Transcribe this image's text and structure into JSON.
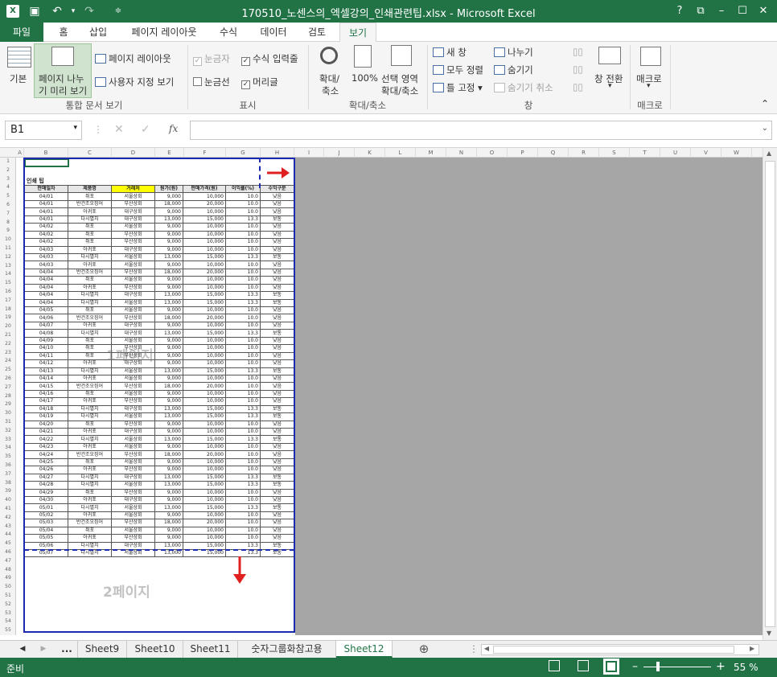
{
  "title": "170510_노센스의_엑셀강의_인쇄관련팁.xlsx - Microsoft Excel",
  "app_logo": "X",
  "window_controls": [
    "?",
    "⧉",
    "–",
    "☐",
    "✕"
  ],
  "tabs": [
    "파일",
    "홈",
    "삽입",
    "페이지 레이아웃",
    "수식",
    "데이터",
    "검토",
    "보기"
  ],
  "ribbon": {
    "normal": "기본",
    "page_break_1": "페이지 나누",
    "page_break_2": "기 미리 보기",
    "page_layout": "페이지 레이아웃",
    "custom_views": "사용자 지정 보기",
    "group_views": "통합 문서 보기",
    "ruler": "눈금자",
    "formula_bar": "수식 입력줄",
    "gridlines": "눈금선",
    "headings": "머리글",
    "group_show": "표시",
    "zoom_1": "확대/",
    "zoom_2": "축소",
    "zoom100": "100%",
    "zoom_sel_1": "선택 영역",
    "zoom_sel_2": "확대/축소",
    "group_zoom": "확대/축소",
    "new_window": "새 창",
    "arrange_all": "모두 정렬",
    "freeze": "틀 고정",
    "split": "나누기",
    "hide": "숨기기",
    "unhide": "숨기기 취소",
    "switch_1": "창 전환",
    "group_window": "창",
    "macro": "매크로",
    "group_macro": "매크로"
  },
  "name_box": "B1",
  "fx": "fx",
  "columns": [
    "A",
    "B",
    "C",
    "D",
    "E",
    "F",
    "G",
    "H",
    "I",
    "J",
    "K",
    "L",
    "M",
    "N",
    "O",
    "P",
    "Q",
    "R",
    "S",
    "T",
    "U",
    "V",
    "W"
  ],
  "sheet_title": "인쇄 팁",
  "headers": [
    "판매일자",
    "제품명",
    "거래처",
    "원가(원)",
    "판매가격(원)",
    "이익률(%)",
    "수익구분"
  ],
  "rows": [
    [
      "04/01",
      "쥐포",
      "서울상회",
      "9,000",
      "10,000",
      "10.0",
      "낮음"
    ],
    [
      "04/01",
      "반건조오징어",
      "부산상회",
      "18,000",
      "20,000",
      "10.0",
      "낮음"
    ],
    [
      "04/01",
      "아귀포",
      "대구상회",
      "9,000",
      "10,000",
      "10.0",
      "낮음"
    ],
    [
      "04/01",
      "다시멸치",
      "대구상회",
      "13,000",
      "15,000",
      "13.3",
      "보통"
    ],
    [
      "04/02",
      "쥐포",
      "서울상회",
      "9,000",
      "10,000",
      "10.0",
      "낮음"
    ],
    [
      "04/02",
      "쥐포",
      "부산상회",
      "9,000",
      "10,000",
      "10.0",
      "낮음"
    ],
    [
      "04/02",
      "쥐포",
      "부산상회",
      "9,000",
      "10,000",
      "10.0",
      "낮음"
    ],
    [
      "04/03",
      "아귀포",
      "대구상회",
      "9,000",
      "10,000",
      "10.0",
      "낮음"
    ],
    [
      "04/03",
      "다시멸치",
      "서울상회",
      "13,000",
      "15,000",
      "13.3",
      "보통"
    ],
    [
      "04/03",
      "아귀포",
      "서울상회",
      "9,000",
      "10,000",
      "10.0",
      "낮음"
    ],
    [
      "04/04",
      "반건조오징어",
      "부산상회",
      "18,000",
      "20,000",
      "10.0",
      "낮음"
    ],
    [
      "04/04",
      "쥐포",
      "서울상회",
      "9,000",
      "10,000",
      "10.0",
      "낮음"
    ],
    [
      "04/04",
      "아귀포",
      "부산상회",
      "9,000",
      "10,000",
      "10.0",
      "낮음"
    ],
    [
      "04/04",
      "다시멸치",
      "대구상회",
      "13,000",
      "15,000",
      "13.3",
      "보통"
    ],
    [
      "04/04",
      "다시멸치",
      "서울상회",
      "13,000",
      "15,000",
      "13.3",
      "보통"
    ],
    [
      "04/05",
      "쥐포",
      "서울상회",
      "9,000",
      "10,000",
      "10.0",
      "낮음"
    ],
    [
      "04/06",
      "반건조오징어",
      "부산상회",
      "18,000",
      "20,000",
      "10.0",
      "낮음"
    ],
    [
      "04/07",
      "아귀포",
      "대구상회",
      "9,000",
      "10,000",
      "10.0",
      "낮음"
    ],
    [
      "04/08",
      "다시멸치",
      "대구상회",
      "13,000",
      "15,000",
      "13.3",
      "보통"
    ],
    [
      "04/09",
      "쥐포",
      "서울상회",
      "9,000",
      "10,000",
      "10.0",
      "낮음"
    ],
    [
      "04/10",
      "쥐포",
      "부산상회",
      "9,000",
      "10,000",
      "10.0",
      "낮음"
    ],
    [
      "04/11",
      "쥐포",
      "부산상회",
      "9,000",
      "10,000",
      "10.0",
      "낮음"
    ],
    [
      "04/12",
      "아귀포",
      "대구상회",
      "9,000",
      "10,000",
      "10.0",
      "낮음"
    ],
    [
      "04/13",
      "다시멸치",
      "서울상회",
      "13,000",
      "15,000",
      "13.3",
      "보통"
    ],
    [
      "04/14",
      "아귀포",
      "서울상회",
      "9,000",
      "10,000",
      "10.0",
      "낮음"
    ],
    [
      "04/15",
      "반건조오징어",
      "부산상회",
      "18,000",
      "20,000",
      "10.0",
      "낮음"
    ],
    [
      "04/16",
      "쥐포",
      "서울상회",
      "9,000",
      "10,000",
      "10.0",
      "낮음"
    ],
    [
      "04/17",
      "아귀포",
      "부산상회",
      "9,000",
      "10,000",
      "10.0",
      "낮음"
    ],
    [
      "04/18",
      "다시멸치",
      "대구상회",
      "13,000",
      "15,000",
      "13.3",
      "보통"
    ],
    [
      "04/19",
      "다시멸치",
      "서울상회",
      "13,000",
      "15,000",
      "13.3",
      "보통"
    ],
    [
      "04/20",
      "쥐포",
      "부산상회",
      "9,000",
      "10,000",
      "10.0",
      "낮음"
    ],
    [
      "04/21",
      "아귀포",
      "대구상회",
      "9,000",
      "10,000",
      "10.0",
      "낮음"
    ],
    [
      "04/22",
      "다시멸치",
      "서울상회",
      "13,000",
      "15,000",
      "13.3",
      "보통"
    ],
    [
      "04/23",
      "아귀포",
      "서울상회",
      "9,000",
      "10,000",
      "10.0",
      "낮음"
    ],
    [
      "04/24",
      "반건조오징어",
      "부산상회",
      "18,000",
      "20,000",
      "10.0",
      "낮음"
    ],
    [
      "04/25",
      "쥐포",
      "서울상회",
      "9,000",
      "10,000",
      "10.0",
      "낮음"
    ],
    [
      "04/26",
      "아귀포",
      "부산상회",
      "9,000",
      "10,000",
      "10.0",
      "낮음"
    ],
    [
      "04/27",
      "다시멸치",
      "대구상회",
      "13,000",
      "15,000",
      "13.3",
      "보통"
    ],
    [
      "04/28",
      "다시멸치",
      "서울상회",
      "13,000",
      "15,000",
      "13.3",
      "보통"
    ],
    [
      "04/29",
      "쥐포",
      "부산상회",
      "9,000",
      "10,000",
      "10.0",
      "낮음"
    ],
    [
      "04/30",
      "아귀포",
      "대구상회",
      "9,000",
      "10,000",
      "10.0",
      "낮음"
    ],
    [
      "05/01",
      "다시멸치",
      "서울상회",
      "13,000",
      "15,000",
      "13.3",
      "보통"
    ],
    [
      "05/02",
      "아귀포",
      "서울상회",
      "9,000",
      "10,000",
      "10.0",
      "낮음"
    ],
    [
      "05/03",
      "반건조오징어",
      "부산상회",
      "18,000",
      "20,000",
      "10.0",
      "낮음"
    ],
    [
      "05/04",
      "쥐포",
      "서울상회",
      "9,000",
      "10,000",
      "10.0",
      "낮음"
    ],
    [
      "05/05",
      "아귀포",
      "부산상회",
      "9,000",
      "10,000",
      "10.0",
      "낮음"
    ],
    [
      "05/06",
      "다시멸치",
      "대구상회",
      "13,000",
      "15,000",
      "13.3",
      "보통"
    ],
    [
      "05/07",
      "다시멸치",
      "서울상회",
      "13,000",
      "15,000",
      "13.3",
      "보통"
    ]
  ],
  "watermark_1": "1페이지",
  "watermark_2": "2페이지",
  "sheet_tabs": [
    "Sheet9",
    "Sheet10",
    "Sheet11",
    "숫자그룹화참고용",
    "Sheet12"
  ],
  "status": "준비",
  "zoom": "55 %",
  "colors": {
    "excel_green": "#217346",
    "page_border": "#1b2bb0",
    "arrow": "#e02020",
    "header_yellow": "#ffff00"
  }
}
